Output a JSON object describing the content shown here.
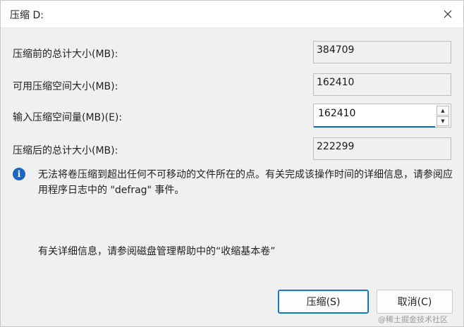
{
  "window": {
    "title": "压缩 D:"
  },
  "fields": {
    "total_before_label": "压缩前的总计大小(MB):",
    "total_before_value": "384709",
    "available_label": "可用压缩空间大小(MB):",
    "available_value": "162410",
    "input_label": "输入压缩空间量(MB)(E):",
    "input_value": "162410",
    "total_after_label": "压缩后的总计大小(MB):",
    "total_after_value": "222299"
  },
  "info": {
    "icon": "info-icon",
    "message": "无法将卷压缩到超出任何不可移动的文件所在的点。有关完成该操作时间的详细信息，请参阅应用程序日志中的 \"defrag\" 事件。"
  },
  "help": {
    "text": "有关详细信息，请参阅磁盘管理帮助中的“收缩基本卷”"
  },
  "buttons": {
    "shrink": "压缩(S)",
    "cancel": "取消(C)"
  },
  "watermark": "@稀土掘金技术社区",
  "colors": {
    "accent": "#0067c0",
    "info": "#1a66c1"
  }
}
